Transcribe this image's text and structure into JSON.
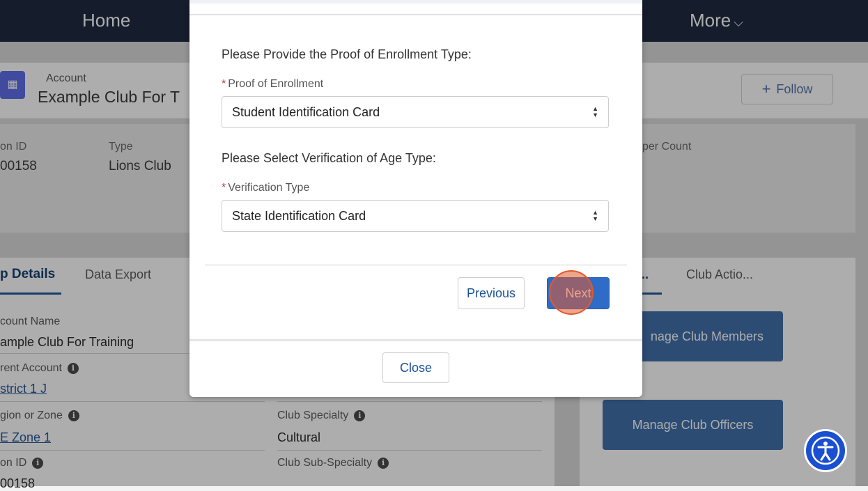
{
  "nav": {
    "home": "Home",
    "more": "More"
  },
  "account": {
    "object_label": "Account",
    "name": "Example Club For T",
    "follow_label": "Follow"
  },
  "highlights": [
    {
      "label": "on ID",
      "value": "00158"
    },
    {
      "label": "Type",
      "value": "Lions Club"
    },
    {
      "label": "per Count",
      "value": ""
    }
  ],
  "left_tabs": [
    {
      "label": "Details",
      "prefix": "p"
    },
    {
      "label": "Data Export"
    }
  ],
  "right_tabs": [
    {
      "label": "..."
    },
    {
      "label": "Club Actio..."
    }
  ],
  "fields": {
    "account_name_label": "count Name",
    "account_name_value": "ample Club For Training",
    "parent_account_label": "rent Account",
    "parent_account_value": "strict 1 J",
    "region_label": "gion or Zone",
    "region_value": "E Zone 1",
    "lion_id_label": "on ID",
    "lion_id_value": "00158",
    "club_specialty_label": "Club Specialty",
    "club_specialty_value": "Cultural",
    "club_subspecialty_label": "Club Sub-Specialty"
  },
  "actions": {
    "manage_members": "nage Club Members",
    "manage_officers": "Manage Club Officers"
  },
  "modal": {
    "proof_question": "Please Provide the Proof of Enrollment Type:",
    "proof_label": "Proof of Enrollment",
    "proof_value": "Student Identification Card",
    "age_question": "Please Select Verification of Age Type:",
    "age_label": "Verification Type",
    "age_value": "State Identification Card",
    "required_mark": "*",
    "previous_label": "Previous",
    "next_label": "Next",
    "close_label": "Close"
  },
  "colors": {
    "nav_bg": "#16213a",
    "brand_button": "#396aa8",
    "next_button": "#2f6cc7",
    "click_indicator": "#e25a2b",
    "accessibility_button": "#1a4fd1"
  },
  "icons": {
    "account_icon": "building-icon",
    "follow_icon": "plus-icon",
    "info_icon": "info-icon",
    "select_arrows": "sort-arrows-icon",
    "accessibility": "accessibility-icon"
  }
}
